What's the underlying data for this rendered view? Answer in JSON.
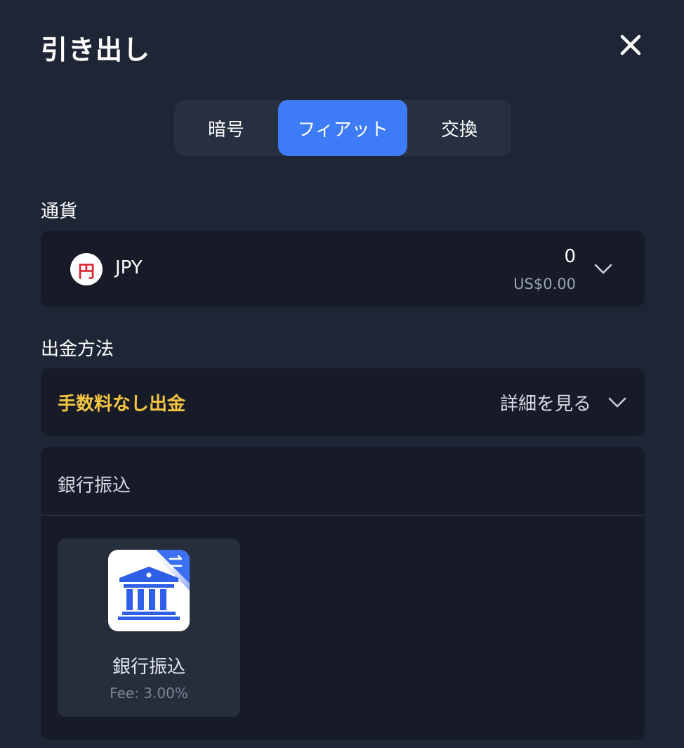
{
  "header": {
    "title": "引き出し"
  },
  "tabs": [
    {
      "label": "暗号",
      "active": false
    },
    {
      "label": "フィアット",
      "active": true
    },
    {
      "label": "交換",
      "active": false
    }
  ],
  "currency": {
    "label": "通貨",
    "icon_glyph": "円",
    "code": "JPY",
    "amount": "0",
    "amount_usd": "US$0.00"
  },
  "method": {
    "label": "出金方法",
    "fee_free_text": "手数料なし出金",
    "details_text": "詳細を見る"
  },
  "bank": {
    "section_title": "銀行振込",
    "option_name": "銀行振込",
    "option_fee": "Fee: 3.00%"
  },
  "colors": {
    "background": "#1e2535",
    "card": "#161b27",
    "accent": "#3d7bf7",
    "highlight": "#f5c542"
  },
  "icons": {
    "close": "close-icon",
    "chevron": "chevron-down-icon",
    "bank": "bank-transfer-icon",
    "currency": "yen-icon"
  }
}
